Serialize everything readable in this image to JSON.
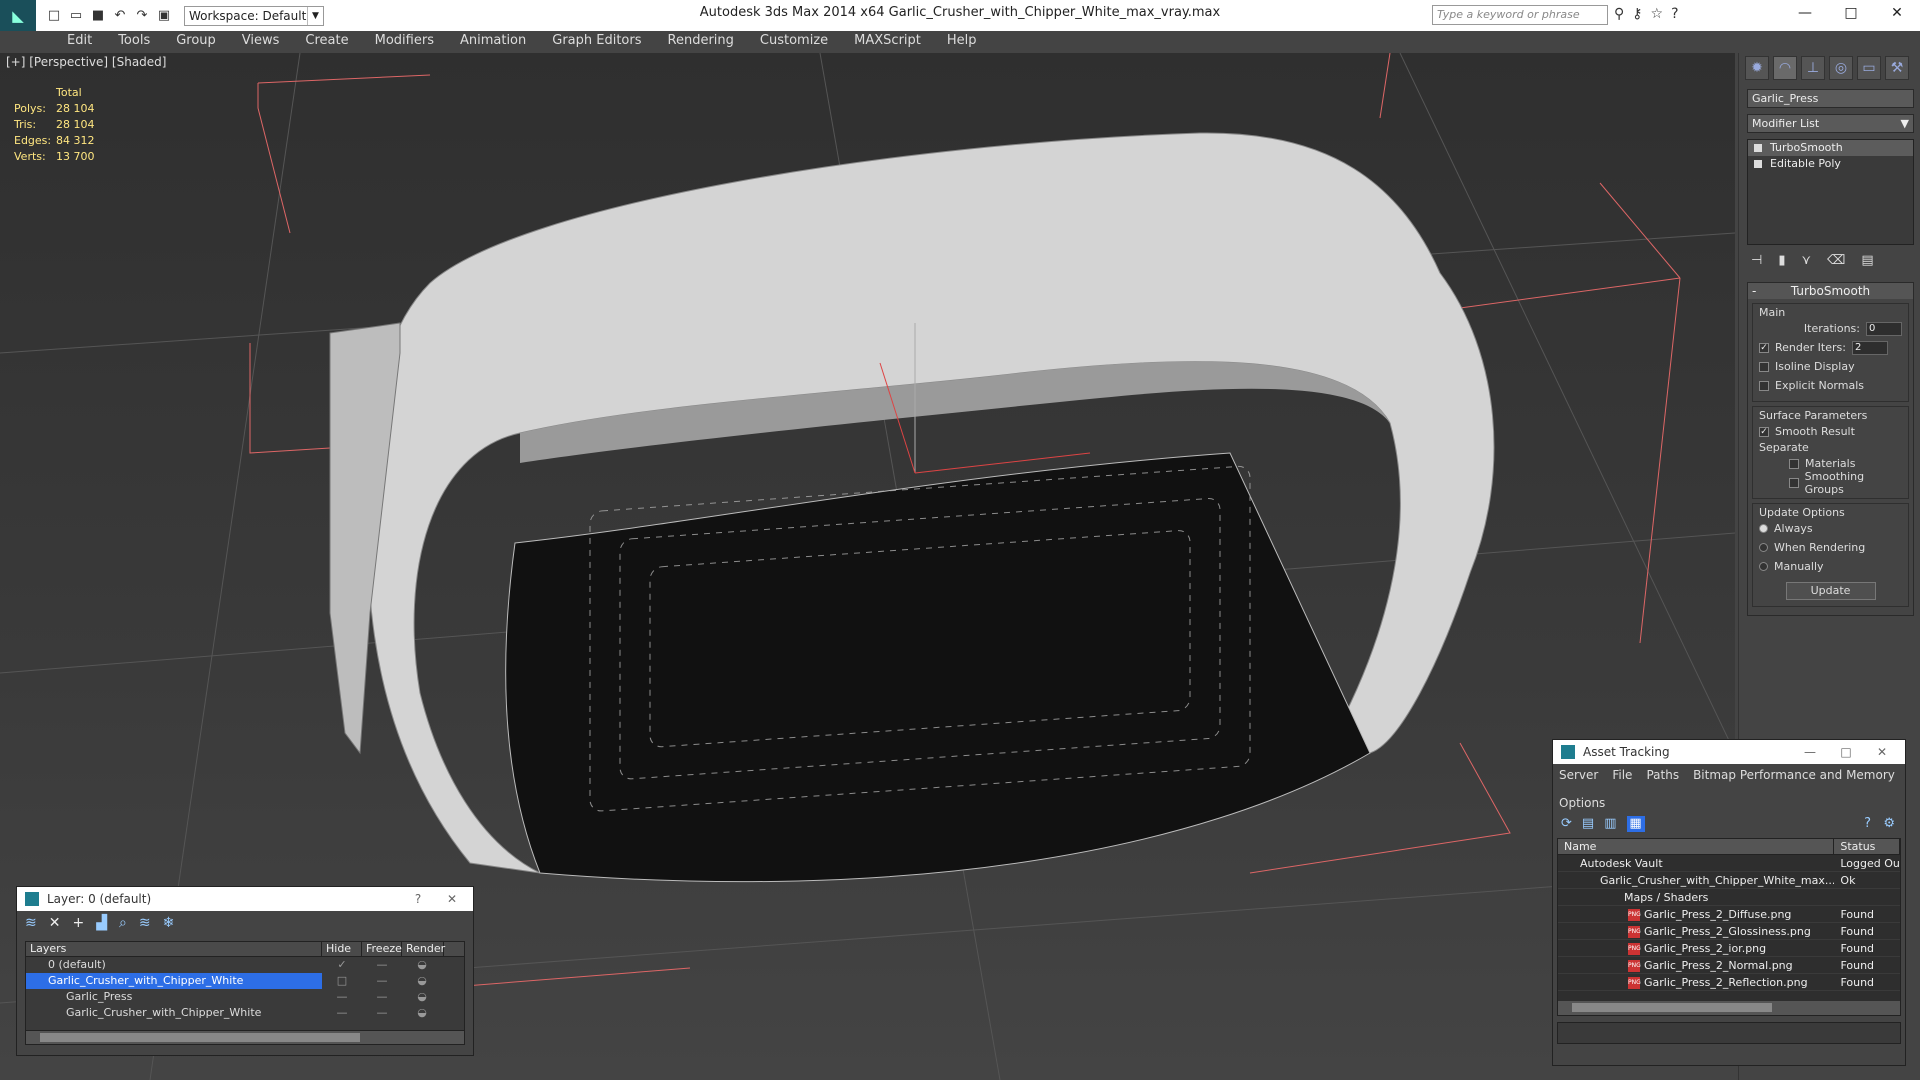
{
  "app": {
    "title": "Autodesk 3ds Max  2014 x64     Garlic_Crusher_with_Chipper_White_max_vray.max",
    "workspace": "Workspace: Default",
    "search_placeholder": "Type a keyword or phrase"
  },
  "menu": [
    "Edit",
    "Tools",
    "Group",
    "Views",
    "Create",
    "Modifiers",
    "Animation",
    "Graph Editors",
    "Rendering",
    "Customize",
    "MAXScript",
    "Help"
  ],
  "viewport": {
    "label": "[+] [Perspective] [Shaded]",
    "stats": {
      "total_label": "Total",
      "rows": [
        {
          "k": "Polys:",
          "v": "28 104"
        },
        {
          "k": "Tris:",
          "v": "28 104"
        },
        {
          "k": "Edges:",
          "v": "84 312"
        },
        {
          "k": "Verts:",
          "v": "13 700"
        }
      ]
    }
  },
  "command_panel": {
    "object_name": "Garlic_Press",
    "modifier_list": "Modifier List",
    "stack": [
      "TurboSmooth",
      "Editable Poly"
    ],
    "rollout_title": "TurboSmooth",
    "main": {
      "title": "Main",
      "iterations_label": "Iterations:",
      "iterations": "0",
      "render_iters_label": "Render Iters:",
      "render_iters": "2",
      "isoline": "Isoline Display",
      "explicit": "Explicit Normals"
    },
    "surface": {
      "title": "Surface Parameters",
      "smooth": "Smooth Result",
      "separate": "Separate",
      "materials": "Materials",
      "smoothing": "Smoothing Groups"
    },
    "update": {
      "title": "Update Options",
      "always": "Always",
      "when": "When Rendering",
      "manually": "Manually",
      "button": "Update"
    }
  },
  "layer": {
    "title": "Layer: 0 (default)",
    "help": "?",
    "columns": [
      "Layers",
      "Hide",
      "Freeze",
      "Render"
    ],
    "rows": [
      "0 (default)",
      "Garlic_Crusher_with_Chipper_White",
      "Garlic_Press",
      "Garlic_Crusher_with_Chipper_White"
    ]
  },
  "asset": {
    "title": "Asset Tracking",
    "menu": [
      "Server",
      "File",
      "Paths",
      "Bitmap Performance and Memory",
      "Options"
    ],
    "columns": [
      "Name",
      "Status"
    ],
    "rows": [
      {
        "name": "Autodesk Vault",
        "status": "Logged Out"
      },
      {
        "name": "Garlic_Crusher_with_Chipper_White_max...",
        "status": "Ok"
      },
      {
        "name": "Maps / Shaders",
        "status": ""
      },
      {
        "name": "Garlic_Press_2_Diffuse.png",
        "status": "Found"
      },
      {
        "name": "Garlic_Press_2_Glossiness.png",
        "status": "Found"
      },
      {
        "name": "Garlic_Press_2_ior.png",
        "status": "Found"
      },
      {
        "name": "Garlic_Press_2_Normal.png",
        "status": "Found"
      },
      {
        "name": "Garlic_Press_2_Reflection.png",
        "status": "Found"
      }
    ],
    "png_tag": "PNG"
  }
}
